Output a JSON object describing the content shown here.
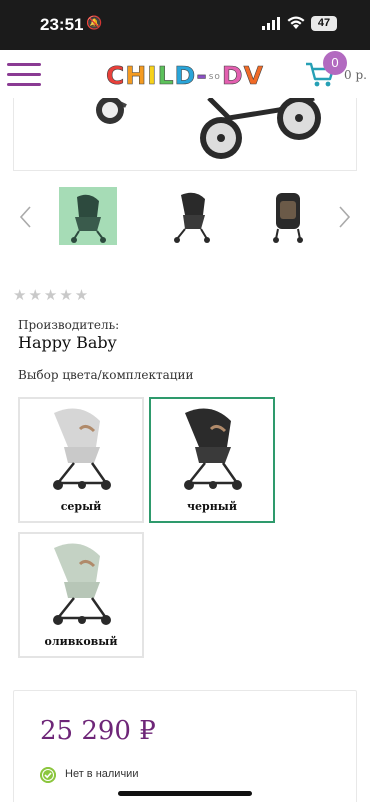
{
  "status_bar": {
    "time": "23:51",
    "battery": "47"
  },
  "header": {
    "logo_letters": [
      "C",
      "H",
      "I",
      "L",
      "D",
      "-",
      "D",
      "V"
    ],
    "logo_small": "so",
    "logo_colors": [
      "#e8403a",
      "#f49b21",
      "#f7d21b",
      "#5cc15b",
      "#2aa5d9",
      "#8a4fc4",
      "#e35fb0",
      "#f06a27"
    ],
    "cart_count": "0",
    "cart_total": "0 р."
  },
  "product": {
    "rating_stars": "★★★★★",
    "manufacturer_label": "Производитель:",
    "manufacturer": "Happy Baby",
    "color_choice_label": "Выбор цвета/комплектации",
    "variants": [
      {
        "name": "серый",
        "color": "#d6d6d6"
      },
      {
        "name": "черный",
        "color": "#2b2b2b"
      },
      {
        "name": "оливковый",
        "color": "#c4d2c4"
      }
    ],
    "price": "25 290 ₽",
    "stock_status": "Нет в наличии"
  },
  "colors": {
    "accent": "#8a3b93",
    "price": "#6e2678",
    "selected_border": "#2e9a6c",
    "stock": "#8cc63f"
  }
}
